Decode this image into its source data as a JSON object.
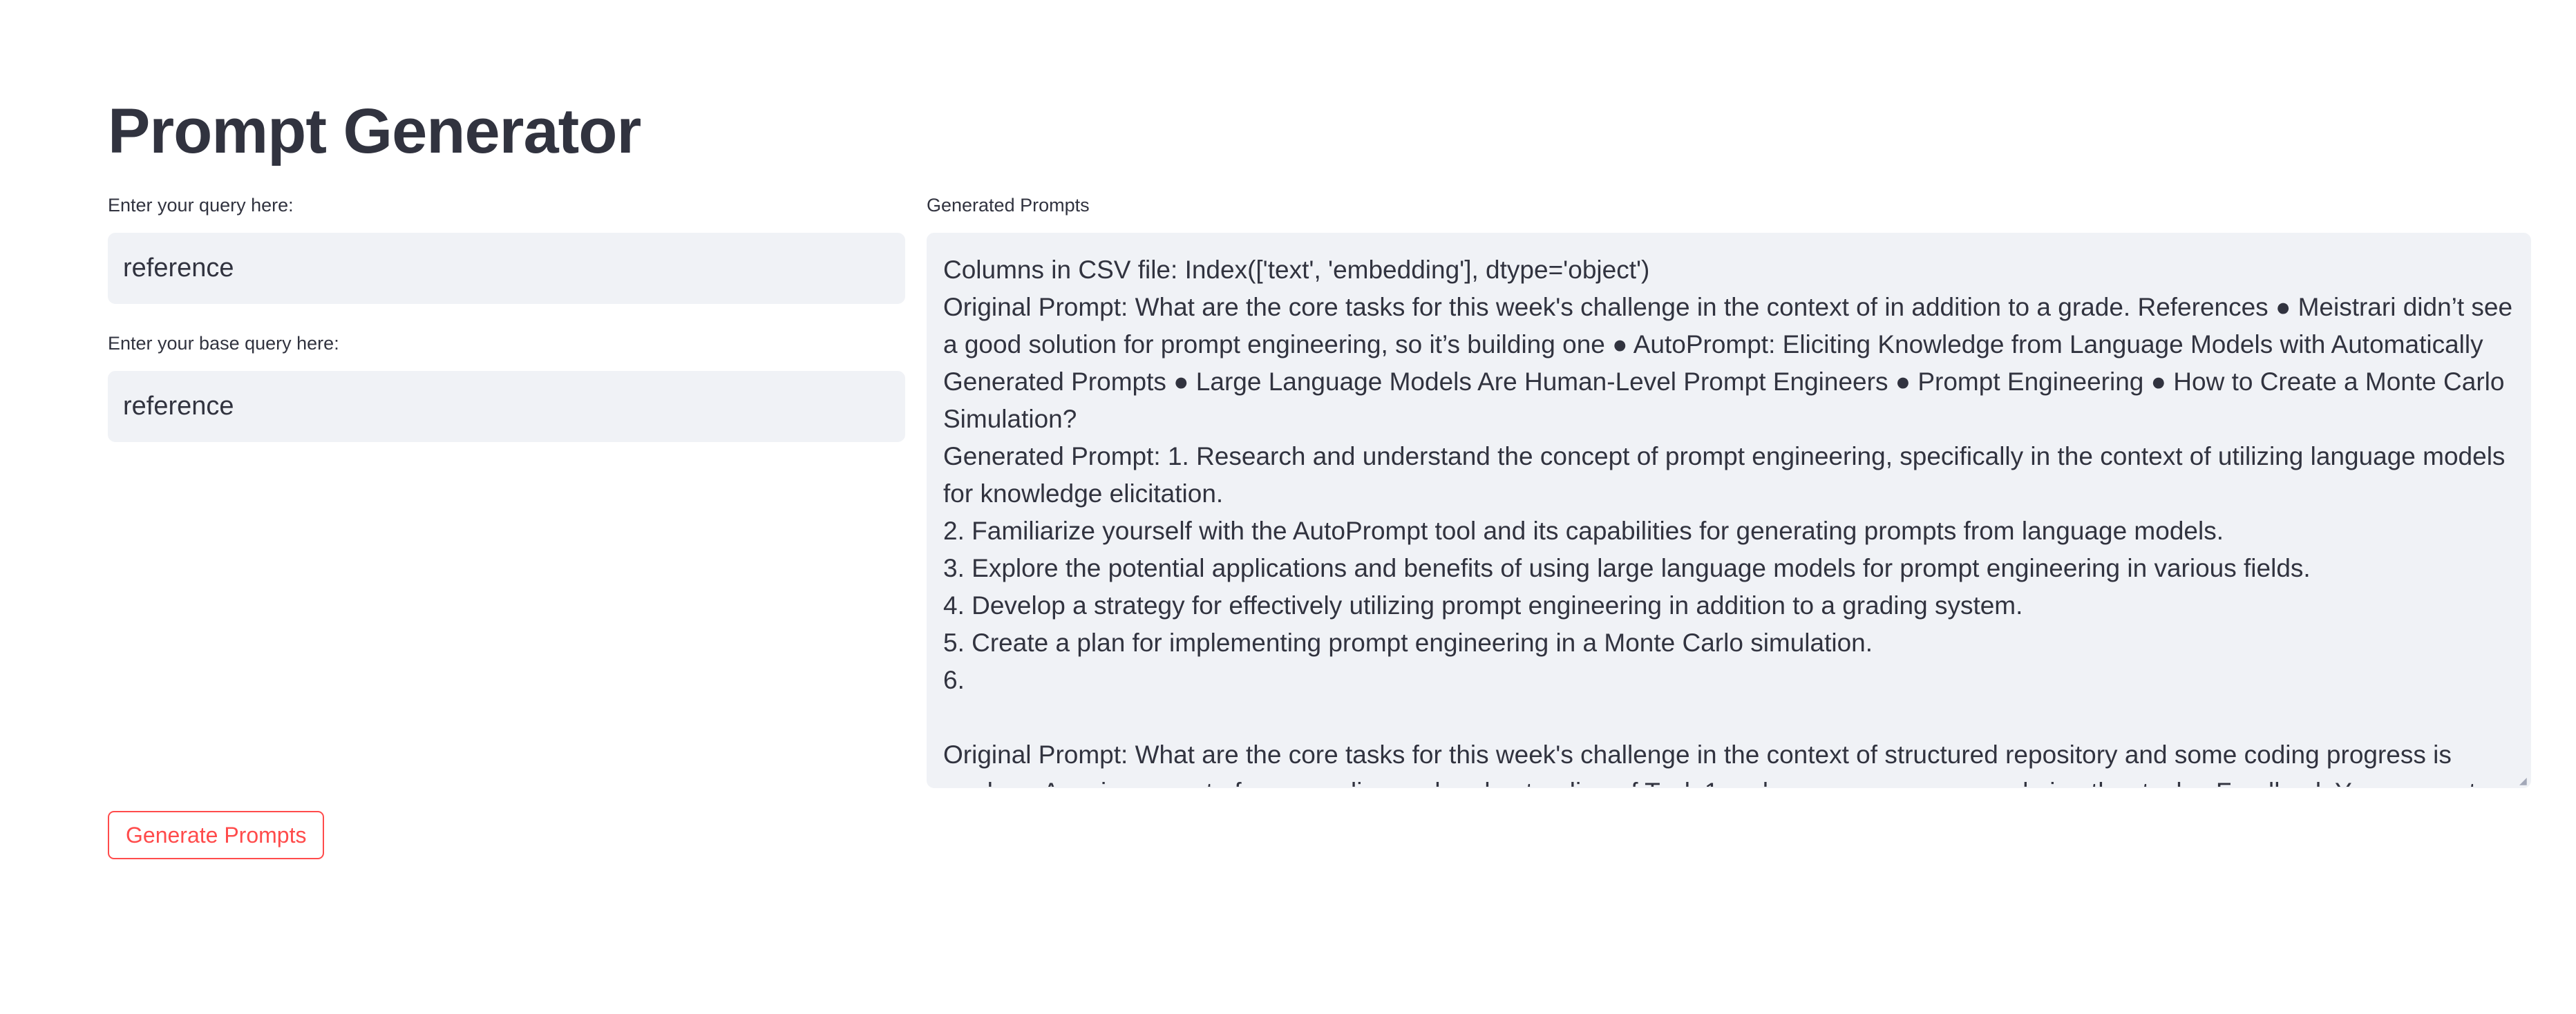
{
  "app": {
    "title": "Prompt Generator"
  },
  "query_field": {
    "label": "Enter your query here:",
    "value": "reference",
    "placeholder": ""
  },
  "base_query_field": {
    "label": "Enter your base query here:",
    "value": "reference",
    "placeholder": ""
  },
  "output": {
    "label": "Generated Prompts",
    "text": "Columns in CSV file: Index(['text', 'embedding'], dtype='object')\nOriginal Prompt: What are the core tasks for this week's challenge in the context of in addition to a grade. References ● Meistrari didn’t see a good solution for prompt engineering, so it’s building one ● AutoPrompt: Eliciting Knowledge from Language Models with Automatically Generated Prompts ● Large Language Models Are Human-Level Prompt Engineers ● Prompt Engineering ● How to Create a Monte Carlo Simulation?\nGenerated Prompt: 1. Research and understand the concept of prompt engineering, specifically in the context of utilizing language models for knowledge elicitation.\n2. Familiarize yourself with the AutoPrompt tool and its capabilities for generating prompts from language models.\n3. Explore the potential applications and benefits of using large language models for prompt engineering in various fields.\n4. Develop a strategy for effectively utilizing prompt engineering in addition to a grading system.\n5. Create a plan for implementing prompt engineering in a Monte Carlo simulation.\n6.\n\nOriginal Prompt: What are the core tasks for this week's challenge in the context of structured repository and some coding progress is made. ● A review report of your reading and understanding of Task 1 and any progress you made in other tasks. Feedback You may not receive detailed"
  },
  "actions": {
    "generate_label": "Generate Prompts"
  },
  "colors": {
    "accent": "#ff4b4b",
    "input_background": "#f0f2f6",
    "text": "#31333f"
  },
  "icons": {
    "resize_grip": "resize-grip-icon"
  }
}
